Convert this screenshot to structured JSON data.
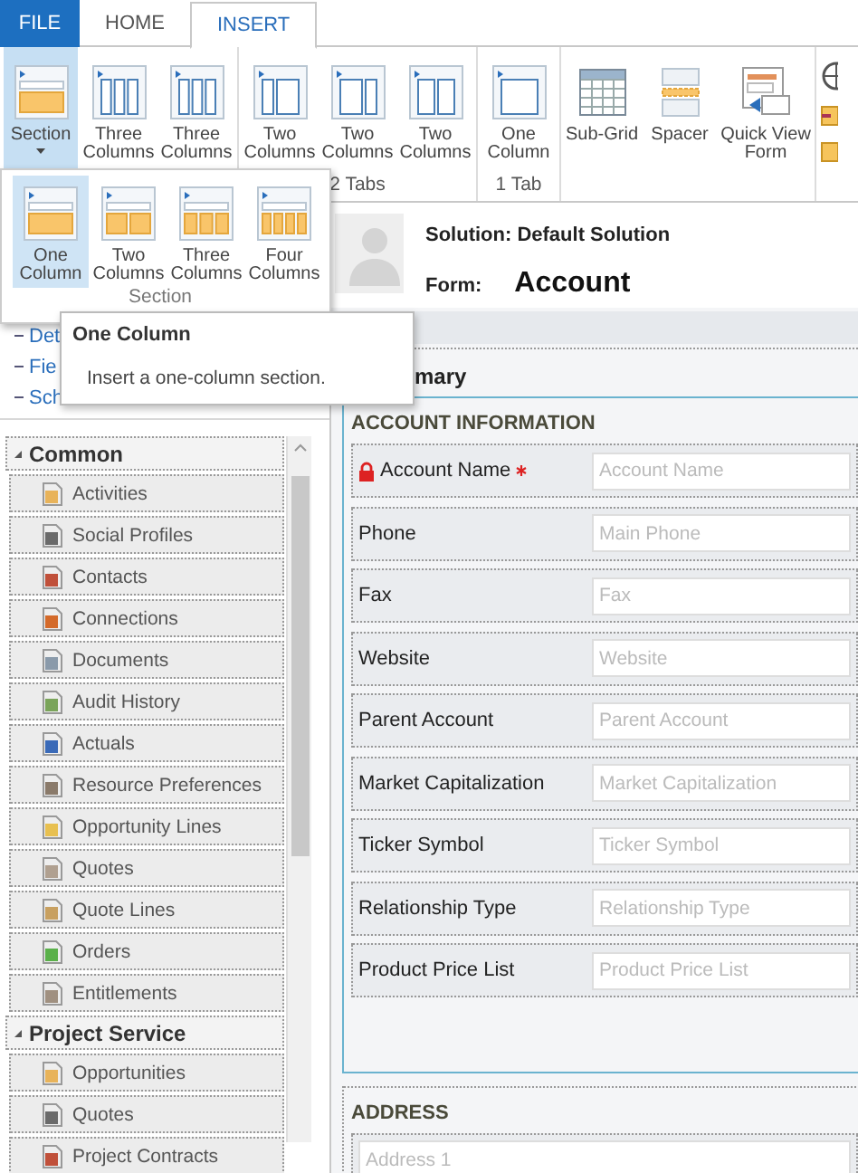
{
  "ribbon": {
    "tabs": [
      {
        "label": "FILE",
        "kind": "file",
        "selected": false
      },
      {
        "label": "HOME",
        "kind": "plain",
        "selected": false
      },
      {
        "label": "INSERT",
        "kind": "plain",
        "selected": true
      }
    ],
    "groups": [
      {
        "buttons": [
          {
            "label": "Section",
            "kind": "section",
            "selected": true,
            "caret": true
          },
          {
            "label": "Three Columns",
            "kind": "cols3",
            "selected": false,
            "caret": false
          },
          {
            "label": "Three Columns",
            "kind": "cols3",
            "selected": false,
            "caret": false
          }
        ]
      },
      {
        "label": "2 Tabs",
        "buttons": [
          {
            "label": "Two Columns",
            "kind": "cols2left",
            "selected": false,
            "caret": false
          },
          {
            "label": "Two Columns",
            "kind": "cols2right",
            "selected": false,
            "caret": false
          },
          {
            "label": "Two Columns",
            "kind": "cols2",
            "selected": false,
            "caret": false
          }
        ]
      },
      {
        "label": "1 Tab",
        "buttons": [
          {
            "label": "One Column",
            "kind": "cols1",
            "selected": false,
            "caret": false
          }
        ]
      },
      {
        "buttons": [
          {
            "label": "Sub-Grid",
            "kind": "subgrid",
            "selected": false,
            "caret": false
          },
          {
            "label": "Spacer",
            "kind": "spacer",
            "selected": false,
            "caret": false
          },
          {
            "label": "Quick View Form",
            "kind": "quickview",
            "selected": false,
            "caret": false
          }
        ]
      }
    ]
  },
  "section_menu": {
    "items": [
      {
        "label": "One Column",
        "kind": "one",
        "selected": true
      },
      {
        "label": "Two Columns",
        "kind": "two",
        "selected": false
      },
      {
        "label": "Three Columns",
        "kind": "three",
        "selected": false
      },
      {
        "label": "Four Columns",
        "kind": "four",
        "selected": false
      }
    ],
    "group_label": "Section"
  },
  "tooltip": {
    "title": "One Column",
    "text": "Insert a one-column section."
  },
  "navigation": {
    "tree": [
      "Det",
      "Fie",
      "Sch"
    ],
    "sections": [
      {
        "title": "Common",
        "items": [
          "Activities",
          "Social Profiles",
          "Contacts",
          "Connections",
          "Documents",
          "Audit History",
          "Actuals",
          "Resource Preferences",
          "Opportunity Lines",
          "Quotes",
          "Quote Lines",
          "Orders",
          "Entitlements"
        ]
      },
      {
        "title": "Project Service",
        "items": [
          "Opportunities",
          "Quotes",
          "Project Contracts"
        ]
      }
    ]
  },
  "header": {
    "solution": "Solution: Default Solution",
    "form_label": "Form:",
    "form_name": "Account"
  },
  "form": {
    "tab_title": "mary",
    "sections": [
      {
        "title": "ACCOUNT INFORMATION",
        "selected": true,
        "fields": [
          {
            "label": "Account Name",
            "placeholder": "Account Name",
            "required": true,
            "locked": true
          },
          {
            "label": "Phone",
            "placeholder": "Main Phone",
            "required": false,
            "locked": false
          },
          {
            "label": "Fax",
            "placeholder": "Fax",
            "required": false,
            "locked": false
          },
          {
            "label": "Website",
            "placeholder": "Website",
            "required": false,
            "locked": false
          },
          {
            "label": "Parent Account",
            "placeholder": "Parent Account",
            "required": false,
            "locked": false
          },
          {
            "label": "Market Capitalization",
            "placeholder": "Market Capitalization",
            "required": false,
            "locked": false
          },
          {
            "label": "Ticker Symbol",
            "placeholder": "Ticker Symbol",
            "required": false,
            "locked": false
          },
          {
            "label": "Relationship Type",
            "placeholder": "Relationship Type",
            "required": false,
            "locked": false
          },
          {
            "label": "Product Price List",
            "placeholder": "Product Price List",
            "required": false,
            "locked": false
          }
        ]
      },
      {
        "title": "ADDRESS",
        "selected": false,
        "fields": [
          {
            "placeholder": "Address 1",
            "required": false,
            "locked": false
          }
        ]
      }
    ]
  }
}
